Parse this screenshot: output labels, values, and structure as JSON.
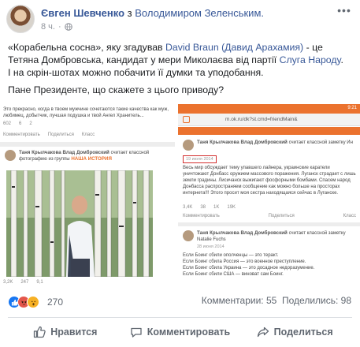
{
  "header": {
    "author": "Євген Шевченко",
    "with_prefix": " з ",
    "tagged": "Володимиром Зеленським.",
    "time": "8 ч.",
    "time_sep": "·",
    "more_glyph": "•••"
  },
  "post": {
    "p1_a": "«Корабельна сосна», яку згадував ",
    "p1_link1": "David Braun (Давид Арахамия)",
    "p1_b": " - це Тетяна Домбровська, кандидат у мери Миколаєва від партії ",
    "p1_link2": "Слуга Народу",
    "p1_c": ".",
    "p2": "І на скрін-шотах можно побачити її думки та уподобання.",
    "p3": "Пане Президенте, що скажете з цього приводу?"
  },
  "shot1": {
    "quote": "Это прекрасно, когда в твоем мужчине сочетаются такие качества как муж, любимец, добытчик, лучшая подушка и твой Ангел Хранитель...",
    "top_counts": [
      "602",
      "6",
      "2"
    ],
    "comment": "Комментировать",
    "share": "Поделиться",
    "klass": "Класс",
    "name": "Таня Крылчакова Влад Домбровский",
    "liked_text": "считает классной фотографию из группы",
    "group": "НАША ИСТОРИЯ",
    "bottom_counts": [
      "3,2K",
      "247",
      "9,1"
    ]
  },
  "shot2": {
    "status_time": "9:21",
    "url": "m.ok.ru/dk?st.cmd=friendMain&",
    "name": "Таня Крылчакова Влад Домбровский",
    "liked_note": "считает классной заметку Ин",
    "date": "19 июля 2014",
    "body": "Весь мир обсуждает тему упавшего лайнера, украинские каратели уничтожают Донбасс оружием массового поражения. Луганск страдает с лишь земли градины. Лисичанск выжигают фосфорными бомбами. Спасем народ Донбасса распространяем сообщение как можно больше на просторах интернета!!! Этого просит моя сестра находящаяся сейчас в Луганске.",
    "counts": [
      "3,4K",
      "38",
      "1K",
      "19K"
    ],
    "comment": "Комментировать",
    "share": "Поделиться",
    "klass": "Класс",
    "name2": "Таня Крылчакова Влад Домбровский",
    "liked_note2": "считает классной заметку Natalie Fuchs",
    "date2": "28 июня 2014",
    "body2": "Если Боинг сбили ополченцы — это теракт.\nЕсли Боинг сбила Россия — это военное преступление.\nЕсли Боинг сбила Украина — это досадное недоразумение.\nЕсли Боинг сбили США — виноват сам Боинг."
  },
  "reactions": {
    "count": "270",
    "comments": "Комментарии: 55",
    "shares": "Поделились: 98"
  },
  "actions": {
    "like": "Нравится",
    "comment": "Комментировать",
    "share": "Поделиться"
  },
  "colors": {
    "link": "#385898",
    "ok_orange": "#eb722e",
    "like_blue": "#1877f2"
  }
}
